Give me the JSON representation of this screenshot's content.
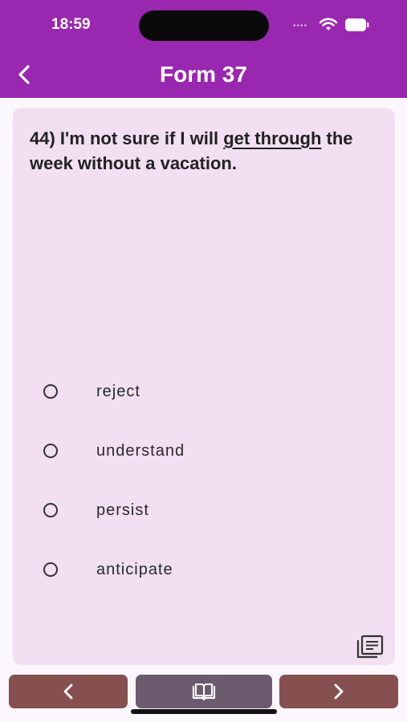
{
  "status_bar": {
    "time": "18:59"
  },
  "header": {
    "title": "Form 37",
    "back_icon": "chevron-left-icon"
  },
  "question": {
    "number_prefix": "44)",
    "text_before": "I'm not sure if I will",
    "underlined": "get through",
    "text_after": "the week without a vacation."
  },
  "options": [
    {
      "label": "reject",
      "selected": false
    },
    {
      "label": "understand",
      "selected": false
    },
    {
      "label": "persist",
      "selected": false
    },
    {
      "label": "anticipate",
      "selected": false
    }
  ],
  "bottom_bar": {
    "prev_icon": "chevron-left-icon",
    "book_icon": "open-book-icon",
    "next_icon": "chevron-right-icon"
  },
  "colors": {
    "header": "#9a27b0",
    "card": "#f2dff2",
    "nav_button": "#875050",
    "book_button": "#6c5a6e"
  }
}
